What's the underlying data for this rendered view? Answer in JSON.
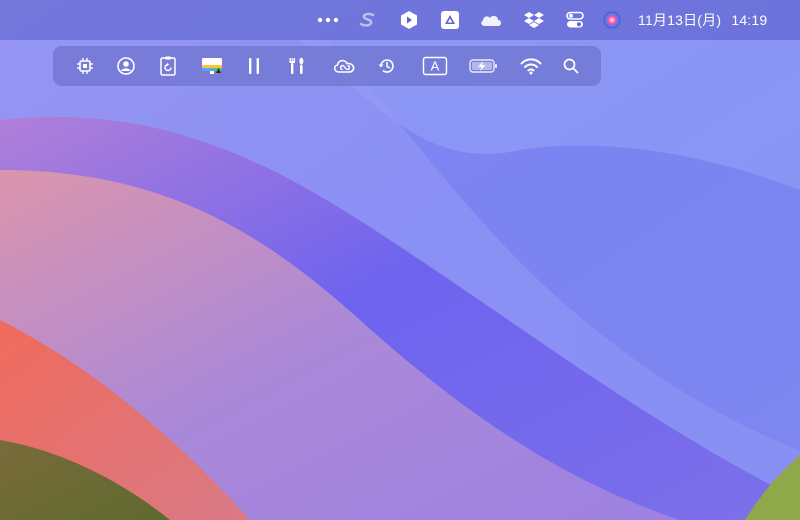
{
  "menubar": {
    "icons": [
      {
        "name": "more-icon"
      },
      {
        "name": "scrivener-icon"
      },
      {
        "name": "alfred-icon"
      },
      {
        "name": "google-drive-icon"
      },
      {
        "name": "onedrive-icon"
      },
      {
        "name": "dropbox-icon"
      },
      {
        "name": "control-center-icon"
      },
      {
        "name": "siri-icon"
      }
    ],
    "clock": {
      "date": "11月13日(月)",
      "time": "14:19"
    }
  },
  "toolbar": {
    "ime_label": "A",
    "icons": [
      {
        "name": "cpu-icon"
      },
      {
        "name": "user-account-icon"
      },
      {
        "name": "clipboard-history-icon"
      },
      {
        "name": "display-brightness-icon"
      },
      {
        "name": "pause-icon"
      },
      {
        "name": "tools-icon"
      },
      {
        "name": "creative-cloud-icon"
      },
      {
        "name": "time-machine-icon"
      },
      {
        "name": "input-method-icon"
      },
      {
        "name": "battery-charging-icon"
      },
      {
        "name": "wifi-icon"
      },
      {
        "name": "spotlight-search-icon"
      }
    ]
  },
  "colors": {
    "menubar_bg": "#6066c8",
    "icon_fg": "#ffffff",
    "wallpaper_base": "#7d80f0",
    "wallpaper_red": "#ee6a5e",
    "wallpaper_green": "#8aa64a"
  }
}
